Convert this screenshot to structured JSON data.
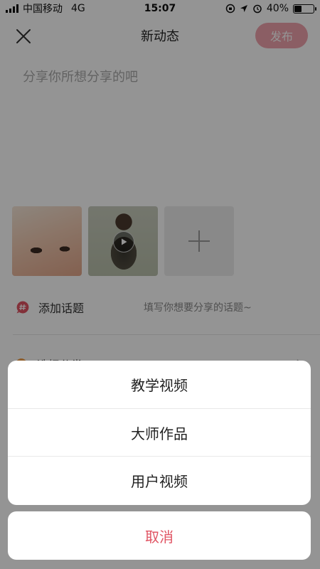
{
  "status_bar": {
    "carrier": "中国移动",
    "network": "4G",
    "time": "15:07",
    "battery": "40%",
    "battery_level": 0.4
  },
  "header": {
    "title": "新动态",
    "publish_label": "发布",
    "close_icon": "close-icon"
  },
  "editor": {
    "placeholder": "分享你所想分享的吧"
  },
  "media": {
    "items": [
      {
        "type": "image",
        "icon": "photo-thumbnail"
      },
      {
        "type": "video",
        "icon": "play-icon"
      }
    ],
    "add_icon": "plus-icon"
  },
  "topic": {
    "label": "添加话题",
    "hint": "填写你想要分享的话题~",
    "icon": "hashtag-icon",
    "icon_color": "#e05463"
  },
  "category": {
    "label": "选择分类",
    "icon_color": "#f5a04a"
  },
  "action_sheet": {
    "options": [
      "教学视频",
      "大师作品",
      "用户视频"
    ],
    "cancel_label": "取消"
  },
  "colors": {
    "accent": "#e05463",
    "publish_bg": "#f0a3ac"
  }
}
